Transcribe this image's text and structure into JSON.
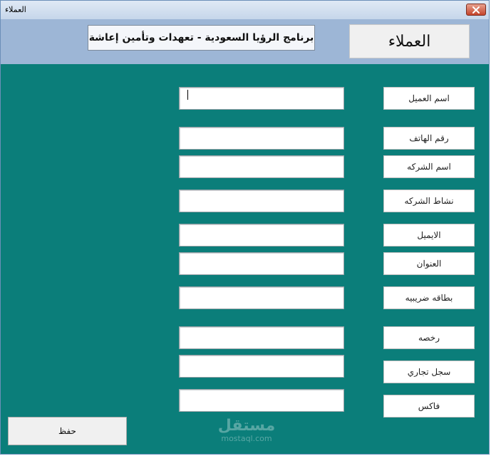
{
  "window": {
    "title": "العملاء"
  },
  "header": {
    "banner": "برنامج الرؤيا السعودية - تعهدات وتأمين إعاشة",
    "form_title": "العملاء"
  },
  "fields": [
    {
      "label": "اسم العميل",
      "value": ""
    },
    {
      "label": "رقم الهاتف",
      "value": ""
    },
    {
      "label": "اسم الشركه",
      "value": ""
    },
    {
      "label": "نشاط الشركه",
      "value": ""
    },
    {
      "label": "الايميل",
      "value": ""
    },
    {
      "label": "العنوان",
      "value": ""
    },
    {
      "label": "بطاقه ضريبيه",
      "value": ""
    },
    {
      "label": "رخصه",
      "value": ""
    },
    {
      "label": "سجل تجاري",
      "value": ""
    },
    {
      "label": "فاكس",
      "value": ""
    }
  ],
  "actions": {
    "save_label": "حفظ"
  },
  "watermark": {
    "main": "مستقل",
    "sub": "mostaql.com"
  },
  "colors": {
    "body": "#0b7e7a",
    "header": "#9db6d6"
  }
}
